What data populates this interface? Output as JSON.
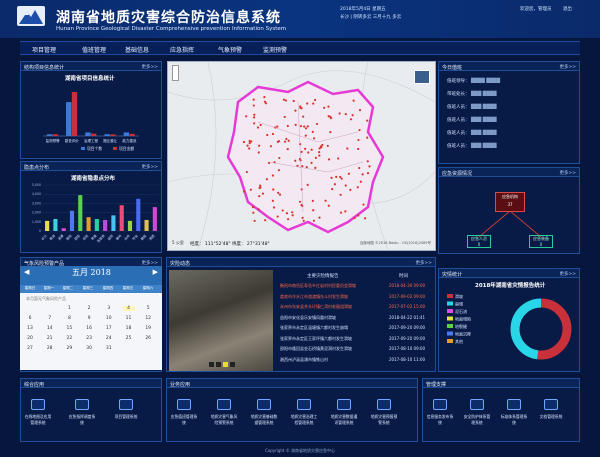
{
  "header": {
    "title": "湖南省地质灾害综合防治信息系统",
    "subtitle": "Hunan Province Geological Disaster Comprehensive prevention Information System",
    "date": "2018年5月4日  星期五",
    "weather": "长沙 | 阴转多云  三月十九  多云",
    "user": "欢迎您，管理员",
    "exit": "退出"
  },
  "nav": [
    "项目管理",
    "值班管理",
    "基础信息",
    "应急指挥",
    "气象预警",
    "监测预警"
  ],
  "panels": {
    "project": {
      "title": "结构项目信息统计",
      "more": "更多>>",
      "chart_title": "湖南省项目信息统计",
      "legend": [
        "项目个数",
        "项目金额"
      ]
    },
    "points": {
      "title": "隐患点分布",
      "more": "更多>>",
      "chart_title": "湖南省隐患点分布"
    },
    "map": {
      "title": "",
      "scale": "5 公里",
      "coord": "经度： 111°52'48\"   纬度： 27°31'48\"",
      "credit": "百度地图 ©2018 Baidu - GS(2016)2089号"
    },
    "today": {
      "title": "今日值班",
      "more": "更多>>",
      "rows": [
        {
          "k": "值班领导：",
          "v": "████ ████"
        },
        {
          "k": "带班处长：",
          "v": "███  ████"
        },
        {
          "k": "值班人员：",
          "v": "███  ████"
        },
        {
          "k": "值班人员：",
          "v": "███  ████"
        },
        {
          "k": "值班人员：",
          "v": "███  ████"
        },
        {
          "k": "值班人员：",
          "v": "███  ████"
        }
      ]
    },
    "emergency": {
      "title": "应急资源情况",
      "more": "更多>>",
      "center": "应急机构",
      "center_val": "37",
      "left": "应急人员",
      "left_val": "0",
      "right": "应急装备",
      "right_val": "0"
    },
    "forecast": {
      "title": "气象风险预警产品",
      "more": "更多>>",
      "month": "五月 2018",
      "weekdays": [
        "星期日",
        "星期一",
        "星期二",
        "星期三",
        "星期四",
        "星期五",
        "星期六"
      ],
      "days": [
        "",
        "",
        "1",
        "2",
        "3",
        "4",
        "5",
        "6",
        "7",
        "8",
        "9",
        "10",
        "11",
        "12",
        "13",
        "14",
        "15",
        "16",
        "17",
        "18",
        "19",
        "20",
        "21",
        "22",
        "23",
        "24",
        "25",
        "26",
        "27",
        "28",
        "29",
        "30",
        "31",
        "",
        ""
      ],
      "note": "本月暂无气象风险产品"
    },
    "news": {
      "title": "灾险动态",
      "more": "更多>>",
      "col1": "主要灾险情报告",
      "col2": "时间",
      "rows": [
        {
          "t": "衡阳市南岳区寿岳乡红岩村村民委员会滑坡",
          "d": "2018-04-30 09:00",
          "hot": true
        },
        {
          "t": "娄底市冷水江市渣渡镇东斗村发生滑坡",
          "d": "2017-09-02 09:00",
          "hot": true
        },
        {
          "t": "永州市东安县井头圩镇仁湾村老屋组滑坡",
          "d": "2017-07-02 15:00",
          "hot": true
        },
        {
          "t": "益阳市安化县乐安镇凤凰村滑坡",
          "d": "2018-04-22 01:41",
          "hot": false
        },
        {
          "t": "张家界市永定区温塘镇六都村发生崩塌",
          "d": "2017-09-20 09:00",
          "hot": false
        },
        {
          "t": "张家界市永定区王家坪镇六都村发生滑坡",
          "d": "2017-09-20 09:00",
          "hot": false
        },
        {
          "t": "邵阳市隆回县金石桥镇黄泥洞村发生滑坡",
          "d": "2017-08-10 09:00",
          "hot": false
        },
        {
          "t": "湘西州泸溪县浦市镇铁山村",
          "d": "2017-08-10 11:00",
          "hot": false
        }
      ]
    },
    "disaster": {
      "title": "灾情统计",
      "more": "更多>>",
      "chart_title": "2018年湖南省灾情报告统计",
      "legend": [
        "滑坡",
        "崩塌",
        "泥石流",
        "地面塌陷",
        "地裂缝",
        "地面沉降",
        "其他"
      ]
    },
    "apps1": {
      "title": "综合应用",
      "items": [
        "在线地图及应用管理系统",
        "应急指挥调度系统",
        "项目管理系统"
      ]
    },
    "apps2": {
      "title": "业务应用",
      "items": [
        "应急值班管理系统",
        "地质灾害气象风险预警系统",
        "地质灾害基础数据管理系统",
        "地质灾害治理工程管理系统",
        "地质灾害数据通讯管理系统",
        "地质灾害预报预警系统"
      ]
    },
    "apps3": {
      "title": "管理支撑",
      "items": [
        "信息服务发布系统",
        "安全防护体系管理系统",
        "标准体系管理系统",
        "文档管理系统"
      ]
    }
  },
  "footer": "Copyright © 湖南省地质灾害应急中心",
  "chart_data": [
    {
      "type": "bar",
      "title": "湖南省项目信息统计",
      "categories": [
        "监测预警",
        "勘查评价",
        "治理工程",
        "搬迁避让",
        "能力建设"
      ],
      "series": [
        {
          "name": "项目个数",
          "values": [
            1,
            19,
            2,
            1,
            2
          ]
        },
        {
          "name": "项目金额",
          "values": [
            900,
            22000,
            1200,
            800,
            1100
          ]
        }
      ],
      "ylim": [
        0,
        28
      ]
    },
    {
      "type": "bar",
      "title": "湖南省隐患点分布",
      "categories": [
        "长沙",
        "株洲",
        "湘潭",
        "衡阳",
        "邵阳",
        "岳阳",
        "常德",
        "张家界",
        "益阳",
        "郴州",
        "永州",
        "怀化",
        "娄底",
        "湘西"
      ],
      "values": [
        1100,
        1300,
        300,
        2200,
        3900,
        1500,
        1300,
        1200,
        1700,
        2800,
        1100,
        3500,
        1200,
        2600
      ],
      "ylim": [
        0,
        5000
      ]
    },
    {
      "type": "pie",
      "title": "2018年湖南省灾情报告统计",
      "labels": [
        "滑坡",
        "崩塌",
        "泥石流",
        "地面塌陷",
        "地裂缝",
        "地面沉降",
        "其他"
      ],
      "values": [
        52,
        48,
        0,
        0,
        0,
        0,
        0
      ]
    }
  ]
}
